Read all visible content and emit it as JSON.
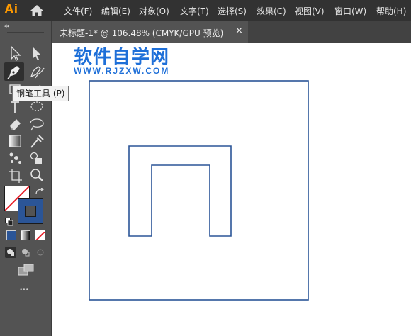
{
  "app": {
    "logo": "Ai"
  },
  "menu": [
    "文件(F)",
    "编辑(E)",
    "对象(O)",
    "文字(T)",
    "选择(S)",
    "效果(C)",
    "视图(V)",
    "窗口(W)",
    "帮助(H)"
  ],
  "document_tab": {
    "title": "未标题-1* @ 106.48% (CMYK/GPU 预览)",
    "close": "×"
  },
  "toolbar": {
    "collapse": "◂◂",
    "tooltip": "钢笔工具 (P)",
    "more": "•••",
    "fill_color": "#ffffff",
    "stroke_color": "#2b5597"
  },
  "watermark": {
    "title": "软件自学网",
    "url": "WWW.RJZXW.COM"
  },
  "colors": {
    "accent": "#ff9a00",
    "stroke": "#2b5597",
    "watermark": "#1e6fd8"
  }
}
